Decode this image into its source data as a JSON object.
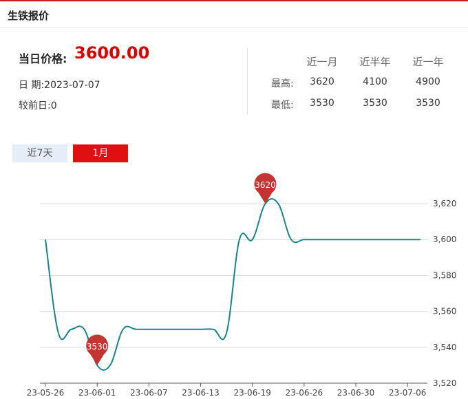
{
  "header": {
    "title": "生铁报价"
  },
  "summary": {
    "price_label": "当日价格:",
    "price_value": "3600.00",
    "date_line": "日  期:2023-07-07",
    "change_line": "较前日:0"
  },
  "stats": {
    "columns": [
      "近一月",
      "近半年",
      "近一年"
    ],
    "rows": [
      {
        "label": "最高:",
        "values": [
          "3620",
          "4100",
          "4900"
        ]
      },
      {
        "label": "最低:",
        "values": [
          "3530",
          "3530",
          "3530"
        ]
      }
    ]
  },
  "tabs": [
    {
      "label": "近7天",
      "active": false
    },
    {
      "label": "1月",
      "active": true
    }
  ],
  "colors": {
    "line": "#14868c",
    "pin": "#c23531",
    "accent": "#e10000",
    "grid": "#d9d9d9"
  },
  "chart_data": {
    "type": "line",
    "title": "",
    "xlabel": "",
    "ylabel": "",
    "x": [
      "23-05-26",
      "23-05-29",
      "23-05-30",
      "23-05-31",
      "23-06-01",
      "23-06-02",
      "23-06-05",
      "23-06-06",
      "23-06-07",
      "23-06-08",
      "23-06-09",
      "23-06-12",
      "23-06-13",
      "23-06-14",
      "23-06-15",
      "23-06-16",
      "23-06-19",
      "23-06-20",
      "23-06-21",
      "23-06-25",
      "23-06-26",
      "23-06-27",
      "23-06-28",
      "23-06-29",
      "23-06-30",
      "23-07-03",
      "23-07-04",
      "23-07-05",
      "23-07-06",
      "23-07-07"
    ],
    "series": [
      {
        "values": [
          3600,
          3548,
          3550,
          3550,
          3530,
          3530,
          3550,
          3550,
          3550,
          3550,
          3550,
          3550,
          3550,
          3550,
          3548,
          3600,
          3600,
          3620,
          3620,
          3600,
          3600,
          3600,
          3600,
          3600,
          3600,
          3600,
          3600,
          3600,
          3600,
          3600
        ]
      }
    ],
    "x_tick_labels": [
      "23-05-26",
      "23-06-01",
      "23-06-07",
      "23-06-13",
      "23-06-19",
      "23-06-26",
      "23-06-30",
      "23-07-06"
    ],
    "y_ticks": [
      3520,
      3540,
      3560,
      3580,
      3600,
      3620
    ],
    "y_tick_labels": [
      "3,520",
      "3,540",
      "3,560",
      "3,580",
      "3,600",
      "3,620"
    ],
    "ylim": [
      3520,
      3620
    ],
    "grid": true,
    "markers": [
      {
        "type": "max",
        "label": "3620",
        "x": "23-06-20",
        "value": 3620
      },
      {
        "type": "min",
        "label": "3530",
        "x": "23-06-01",
        "value": 3530
      }
    ]
  }
}
